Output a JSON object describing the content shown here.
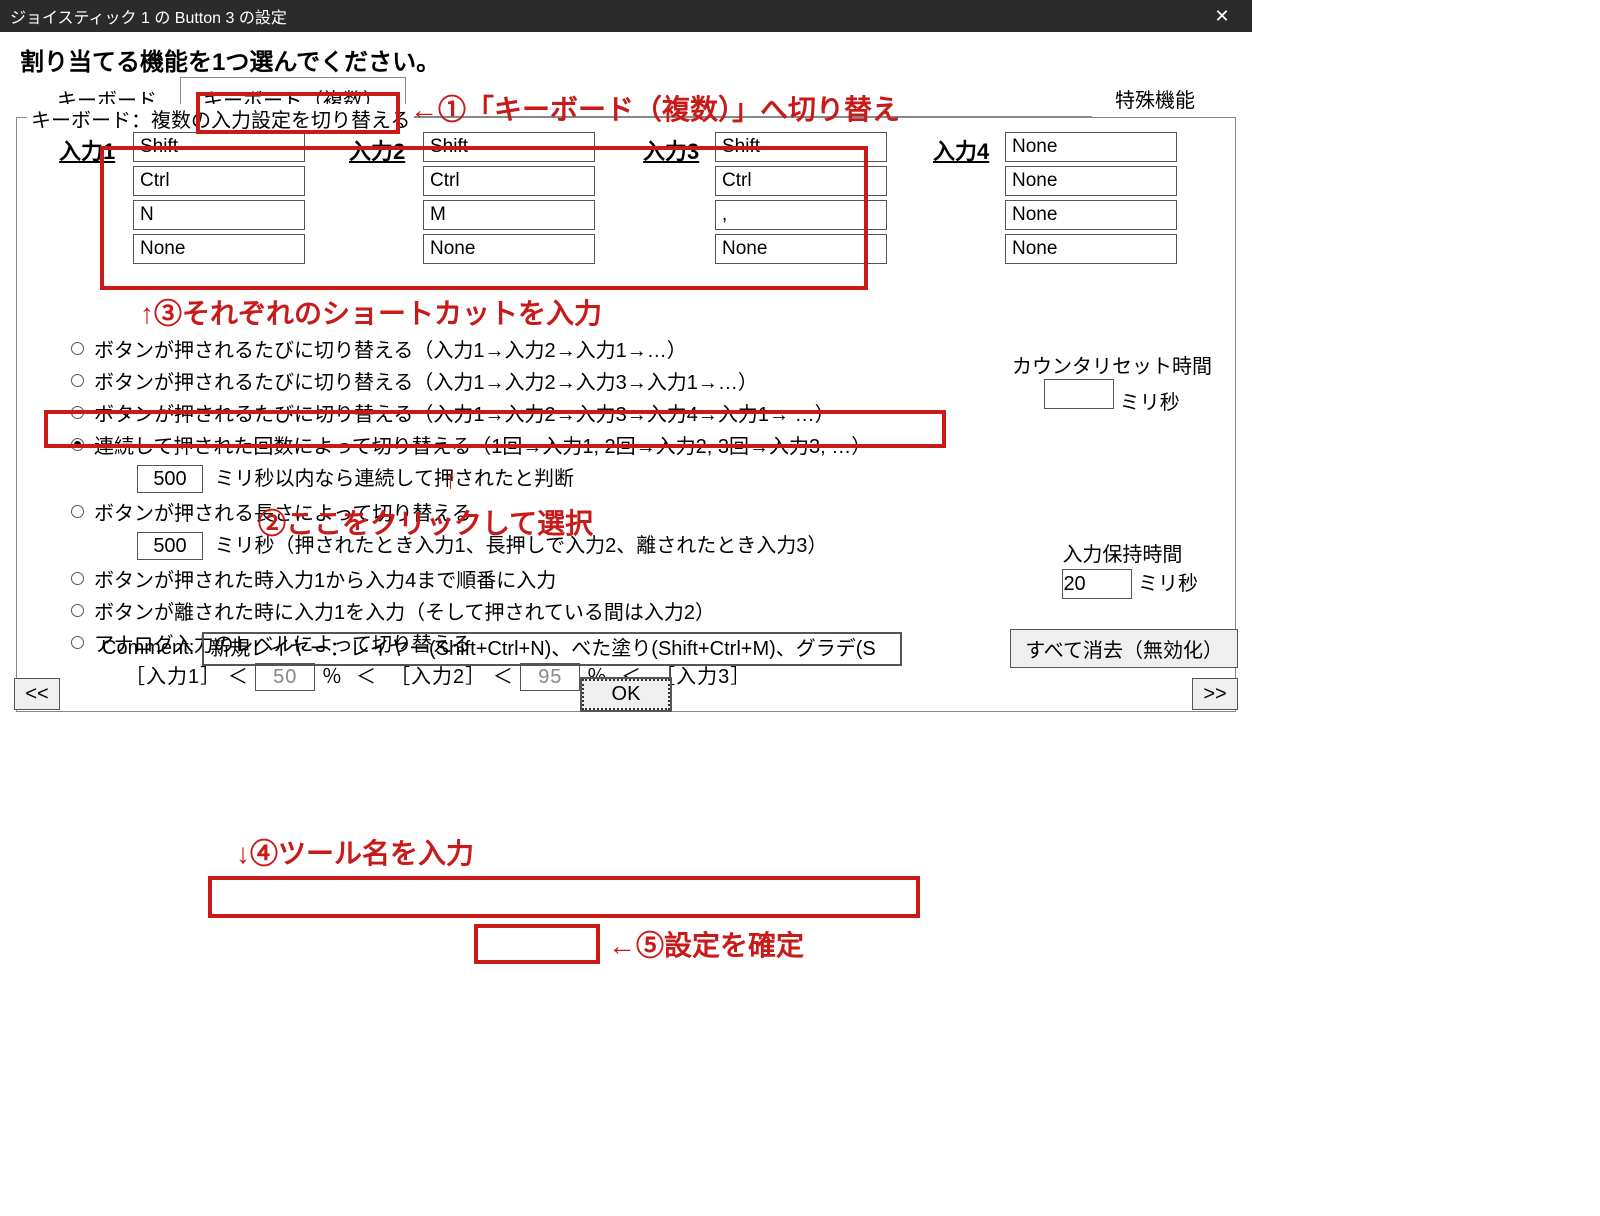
{
  "window": {
    "title": "ジョイスティック 1 の Button 3 の設定"
  },
  "prompt": "割り当てる機能を1つ選んでください。",
  "tabs": {
    "keyboard": "キーボード",
    "keyboard_multi": "キーボード（複数）",
    "special": "特殊機能"
  },
  "group_legend": "キーボード：複数の入力設定を切り替える",
  "inputs": {
    "labels": {
      "i1": "入力1",
      "i2": "入力2",
      "i3": "入力3",
      "i4": "入力4"
    },
    "i1": [
      "Shift",
      "Ctrl",
      "N",
      "None"
    ],
    "i2": [
      "Shift",
      "Ctrl",
      "M",
      "None"
    ],
    "i3": [
      "Shift",
      "Ctrl",
      ",",
      "None"
    ],
    "i4": [
      "None",
      "None",
      "None",
      "None"
    ]
  },
  "radios": {
    "r1": "ボタンが押されるたびに切り替える（入力1→入力2→入力1→…）",
    "r2": "ボタンが押されるたびに切り替える（入力1→入力2→入力3→入力1→…）",
    "r3": "ボタンが押されるたびに切り替える（入力1→入力2→入力3→入力4→入力1→ …）",
    "r4": "連続して押された回数によって切り替える（1回→入力1, 2回→入力2, 3回→入力3, …）",
    "r4_ms_value": "500",
    "r4_ms_label": "ミリ秒以内なら連続して押されたと判断",
    "r5": "ボタンが押される長さによって切り替える",
    "r5_ms_value": "500",
    "r5_ms_tail": "ミリ秒（押されたとき入力1、長押しで入力2、離されたとき入力3）",
    "r6": "ボタンが押された時入力1から入力4まで順番に入力",
    "r7": "ボタンが離された時に入力1を入力（そして押されている間は入力2）",
    "r8": "アナログ入力のレベルによって切り替える"
  },
  "counter": {
    "label": "カウンタリセット時間",
    "unit": "ミリ秒",
    "value": ""
  },
  "hold": {
    "label": "入力保持時間",
    "value": "20",
    "unit": "ミリ秒"
  },
  "level": {
    "i1": "［入力1］",
    "i2": "［入力2］",
    "i3": "［入力3］",
    "lt": "＜",
    "pct": "％",
    "v1": "50",
    "v2": "95"
  },
  "comment": {
    "label": "Comment:",
    "value": "新規レイヤー：レイヤー(Shift+Ctrl+N)、べた塗り(Shift+Ctrl+M)、グラデ(S"
  },
  "buttons": {
    "clear": "すべて消去（無効化）",
    "ok": "OK",
    "prev": "<<",
    "next": ">>"
  },
  "anno": {
    "a1": "←①「キーボード（複数）」へ切り替え",
    "a3": "↑③それぞれのショートカットを入力",
    "a2arrow": "↑",
    "a2": "②ここをクリックして選択",
    "a4": "↓④ツール名を入力",
    "a5": "←⑤設定を確定"
  }
}
